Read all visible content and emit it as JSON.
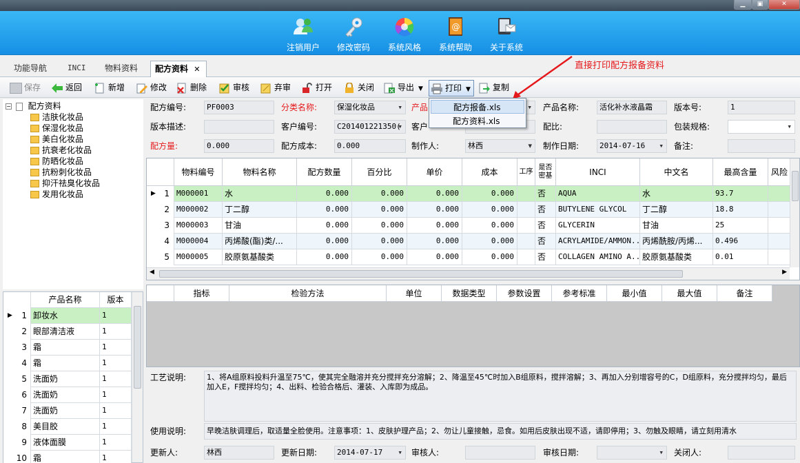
{
  "header": {
    "buttons": [
      "注销用户",
      "修改密码",
      "系统风格",
      "系统帮助",
      "关于系统"
    ]
  },
  "tabs": [
    {
      "label": "功能导航"
    },
    {
      "label": "INCI"
    },
    {
      "label": "物料资料"
    },
    {
      "label": "配方资料",
      "active": true
    }
  ],
  "toolbar": {
    "buttons": [
      "保存",
      "返回",
      "新增",
      "修改",
      "删除",
      "审核",
      "弃审",
      "打开",
      "关闭",
      "导出",
      "打印",
      "复制"
    ]
  },
  "print_menu": {
    "items": [
      "配方报备.xls",
      "配方资料.xls"
    ],
    "highlighted": 0
  },
  "annotation": "直接打印配方报备资料",
  "tree": {
    "root": "配方资料",
    "children": [
      "洁肤化妆品",
      "保湿化妆品",
      "美白化妆品",
      "抗衰老化妆品",
      "防晒化妆品",
      "抗粉刺化妆品",
      "抑汗祛臭化妆品",
      "发用化妆品"
    ]
  },
  "product_grid": {
    "headers": [
      "产品名称",
      "版本"
    ],
    "rows": [
      {
        "no": "1",
        "name": "卸妆水",
        "ver": "1"
      },
      {
        "no": "2",
        "name": "眼部清洁液",
        "ver": "1"
      },
      {
        "no": "3",
        "name": "霜",
        "ver": "1"
      },
      {
        "no": "4",
        "name": "霜",
        "ver": "1"
      },
      {
        "no": "5",
        "name": "洗面奶",
        "ver": "1"
      },
      {
        "no": "6",
        "name": "洗面奶",
        "ver": "1"
      },
      {
        "no": "7",
        "name": "洗面奶",
        "ver": "1"
      },
      {
        "no": "8",
        "name": "美目胶",
        "ver": "1"
      },
      {
        "no": "9",
        "name": "液体面膜",
        "ver": "1"
      },
      {
        "no": "10",
        "name": "霜",
        "ver": "1"
      }
    ]
  },
  "form": {
    "formula_no_label": "配方编号:",
    "formula_no": "PF0003",
    "category_label": "分类名称:",
    "category": "保湿化妆品",
    "product_label": "产品",
    "product_value": "",
    "product_name_label": "产品名称:",
    "product_name": "活化补水液晶霜",
    "version_label": "版本号:",
    "version": "1",
    "desc_label": "版本描述:",
    "desc": "",
    "customer_no_label": "客户编号:",
    "customer_no": "C201401221350(",
    "customer_label": "客户",
    "customer_value": "",
    "ratio_label": "配比:",
    "ratio": "",
    "spec_label": "包装规格:",
    "spec": "",
    "amount_label": "配方量:",
    "amount": "0.000",
    "cost_label": "配方成本:",
    "cost": "0.000",
    "maker_label": "制作人:",
    "maker": "林西",
    "date_label": "制作日期:",
    "date": "2014-07-16",
    "remark_label": "备注:",
    "remark": ""
  },
  "material_grid": {
    "headers": [
      "物料编号",
      "物料名称",
      "配方数量",
      "百分比",
      "单价",
      "成本",
      "工序",
      "是否密基",
      "INCI",
      "中文名",
      "最高含量",
      "风险"
    ],
    "rows": [
      {
        "no": "1",
        "code": "M000001",
        "name": "水",
        "qty": "0.000",
        "pct": "0.000",
        "price": "0.000",
        "cost": "0.000",
        "proc": "",
        "flag": "否",
        "inci": "AQUA",
        "cn": "水",
        "max": "93.7"
      },
      {
        "no": "2",
        "code": "M000002",
        "name": "丁二醇",
        "qty": "0.000",
        "pct": "0.000",
        "price": "0.000",
        "cost": "0.000",
        "proc": "",
        "flag": "否",
        "inci": "BUTYLENE GLYCOL",
        "cn": "丁二醇",
        "max": "18.8"
      },
      {
        "no": "3",
        "code": "M000003",
        "name": "甘油",
        "qty": "0.000",
        "pct": "0.000",
        "price": "0.000",
        "cost": "0.000",
        "proc": "",
        "flag": "否",
        "inci": "GLYCERIN",
        "cn": "甘油",
        "max": "25"
      },
      {
        "no": "4",
        "code": "M000004",
        "name": "丙烯酸(酯)类/...",
        "qty": "0.000",
        "pct": "0.000",
        "price": "0.000",
        "cost": "0.000",
        "proc": "",
        "flag": "否",
        "inci": "ACRYLAMIDE/AMMON...",
        "cn": "丙烯酰胺/丙烯...",
        "max": "0.496"
      },
      {
        "no": "5",
        "code": "M000005",
        "name": "胶原氨基酸类",
        "qty": "0.000",
        "pct": "0.000",
        "price": "0.000",
        "cost": "0.000",
        "proc": "",
        "flag": "否",
        "inci": "COLLAGEN AMINO A...",
        "cn": "胶原氨基酸类",
        "max": "0.01"
      }
    ]
  },
  "index_grid": {
    "headers": [
      "指标",
      "检验方法",
      "单位",
      "数据类型",
      "参数设置",
      "参考标准",
      "最小值",
      "最大值",
      "备注"
    ]
  },
  "process": {
    "label": "工艺说明:",
    "text": "1、将A组原料投料升温至75℃，使其完全融溶并充分搅拌充分溶解；2、降温至45℃时加入B组原料，搅拌溶解；3、再加入分别增容号的C，D组原料，充分搅拌均匀，最后加入E，F搅拌均匀；4、出料、检验合格后、灌装、入库即为成品。"
  },
  "usage": {
    "label": "使用说明:",
    "text": "早晚洁肤调理后，取适量全脸使用。注意事项：1、皮肤护理产品；2、勿让儿童接触，忌食。如用后皮肤出现不适，请即停用；3、勿触及眼睛，请立刻用清水"
  },
  "footer": {
    "updater_label": "更新人:",
    "updater": "林西",
    "update_date_label": "更新日期:",
    "update_date": "2014-07-17",
    "auditor_label": "审核人:",
    "auditor": "",
    "audit_date_label": "审核日期:",
    "audit_date": "",
    "closer_label": "关闭人:",
    "closer": ""
  }
}
